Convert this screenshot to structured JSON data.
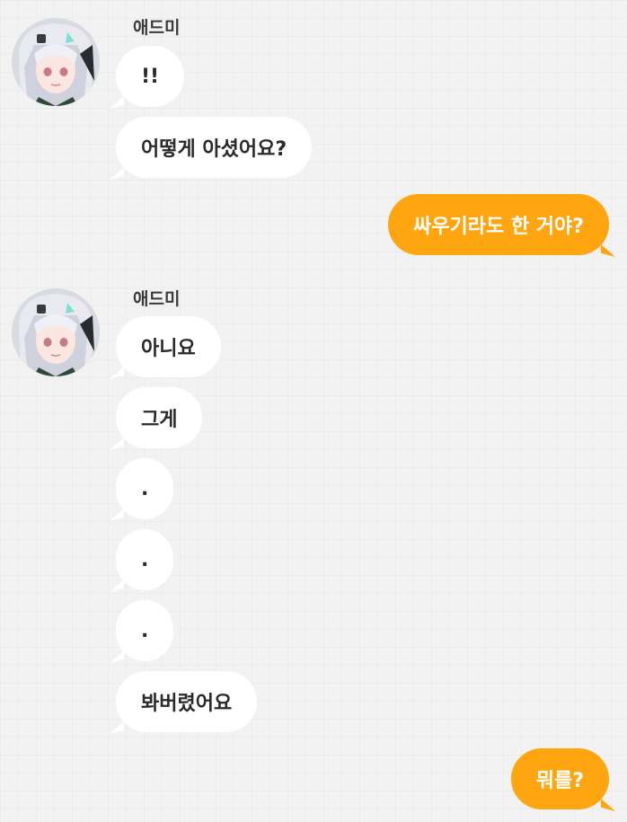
{
  "chat": {
    "sender_name": "애드미",
    "avatar_label": "profile-picture",
    "colors": {
      "incoming_bubble": "#ffffff",
      "outgoing_bubble": "#ffa50f",
      "background": "#f2f2f2"
    },
    "messages": [
      {
        "side": "in",
        "text": "!!"
      },
      {
        "side": "in",
        "text": "어떻게 아셨어요?"
      },
      {
        "side": "out",
        "text": "싸우기라도 한 거야?"
      },
      {
        "side": "in",
        "text": "아니요"
      },
      {
        "side": "in",
        "text": "그게"
      },
      {
        "side": "in",
        "text": "."
      },
      {
        "side": "in",
        "text": "."
      },
      {
        "side": "in",
        "text": "."
      },
      {
        "side": "in",
        "text": "봐버렸어요"
      },
      {
        "side": "out",
        "text": "뭐를?"
      }
    ]
  }
}
